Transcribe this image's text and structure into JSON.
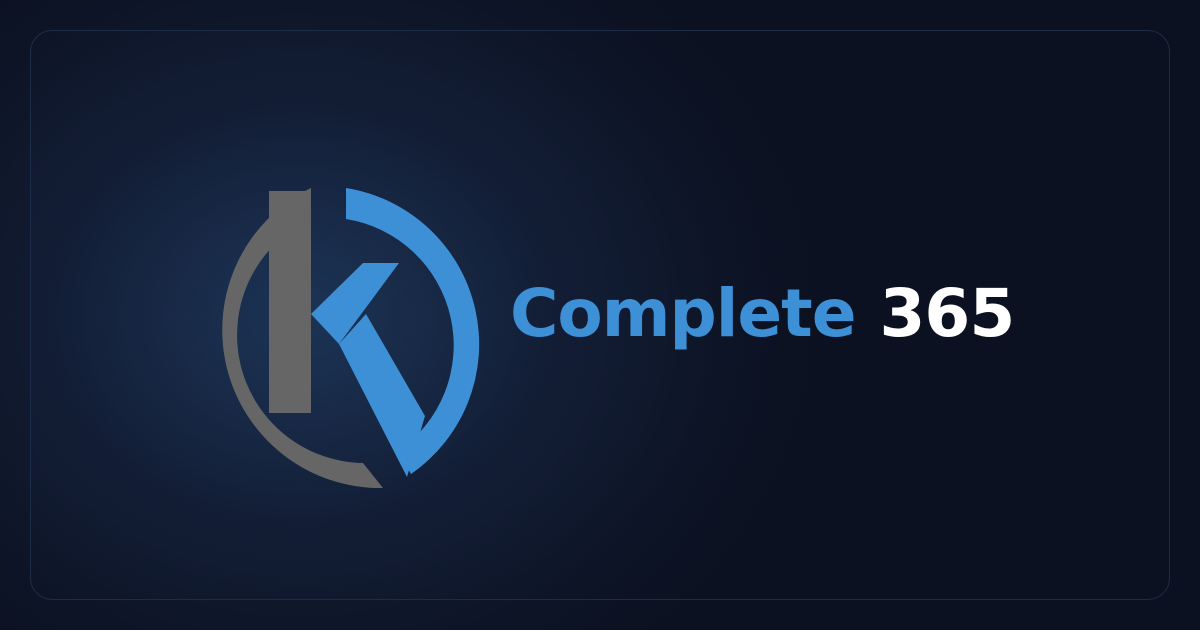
{
  "brand": {
    "name": "Complete",
    "number": "365"
  },
  "colors": {
    "background": "#0d1424",
    "accent_blue": "#3d8fd6",
    "logo_gray": "#666666",
    "text_white": "#ffffff"
  },
  "logo": {
    "icon": "k-circle-logo-icon"
  }
}
